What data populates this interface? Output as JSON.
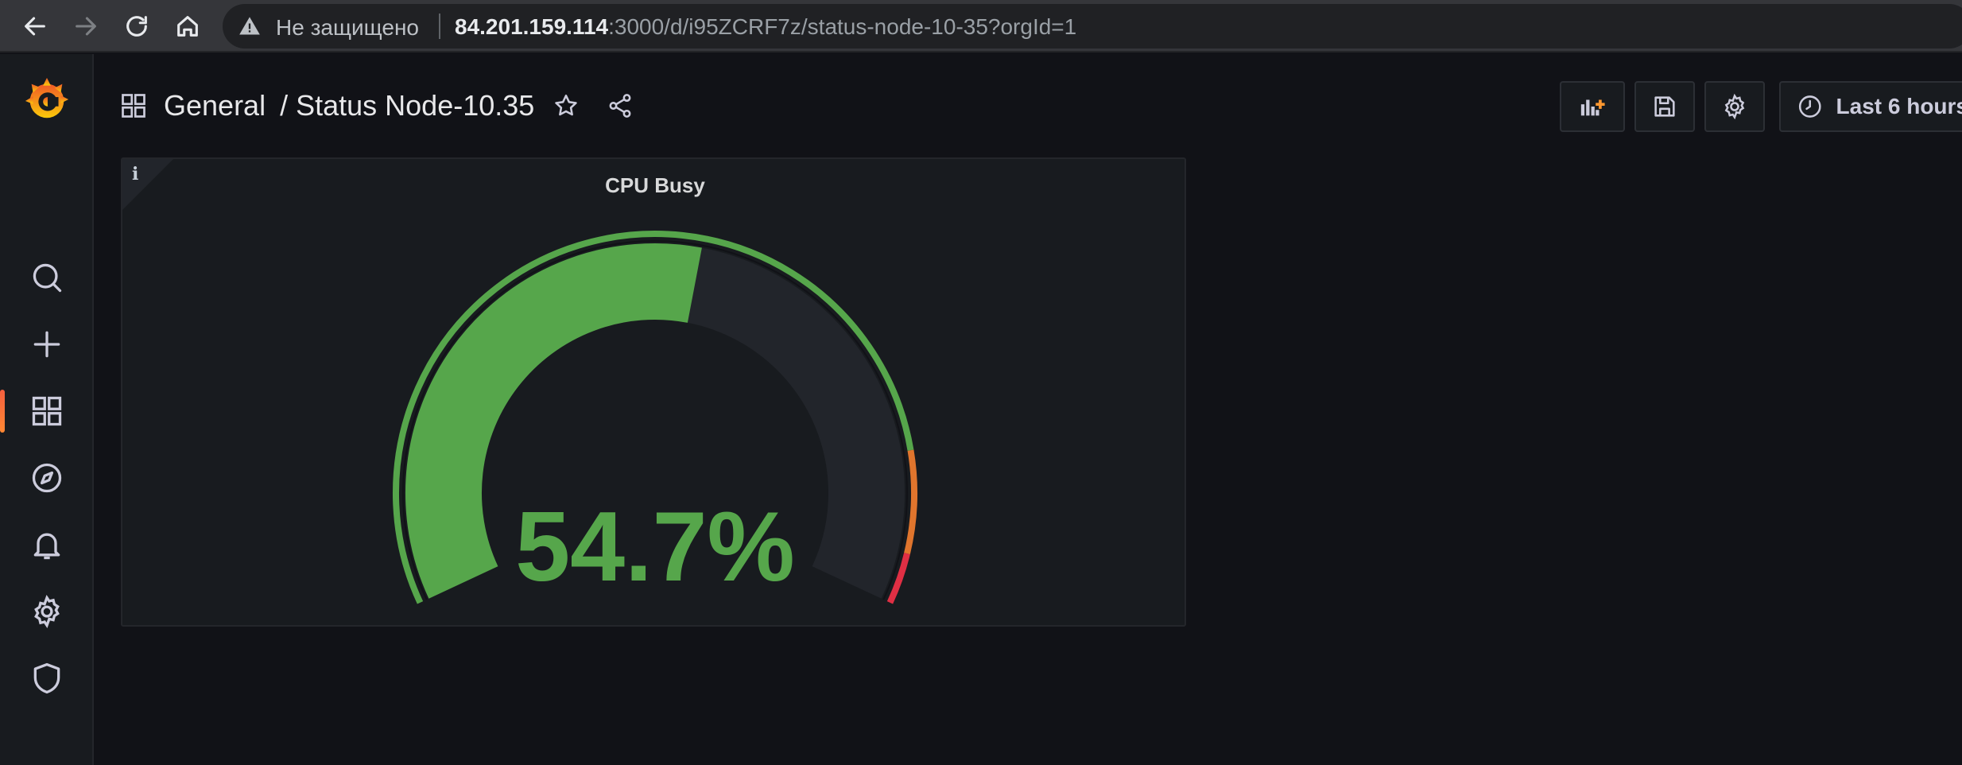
{
  "browser": {
    "security_label": "Не защищено",
    "url_host": "84.201.159.114",
    "url_rest": ":3000/d/i95ZCRF7z/status-node-10-35?orgId=1"
  },
  "breadcrumb": {
    "folder": "General",
    "separator": "/",
    "dashboard": "Status Node-10.35"
  },
  "toolbar": {
    "time_range_label": "Last 6 hours"
  },
  "panel": {
    "title": "CPU Busy",
    "value_text": "54.7%",
    "value_fraction": 0.547,
    "min": 0,
    "max": 100,
    "thresholds": [
      {
        "from": 0,
        "to": 85,
        "color": "#56a64b"
      },
      {
        "from": 85,
        "to": 95,
        "color": "#e0752d"
      },
      {
        "from": 95,
        "to": 100,
        "color": "#e02f44"
      }
    ],
    "value_color": "#56a64b"
  },
  "colors": {
    "background": "#111217",
    "panel": "#181b1f",
    "accent": "#56a64b"
  },
  "icons": [
    "grafana-logo",
    "search-icon",
    "plus-icon",
    "dashboards-icon",
    "explore-icon",
    "alert-bell-icon",
    "gear-icon",
    "shield-icon",
    "star-icon",
    "share-icon",
    "add-panel-icon",
    "save-icon",
    "settings-icon",
    "clock-icon"
  ]
}
